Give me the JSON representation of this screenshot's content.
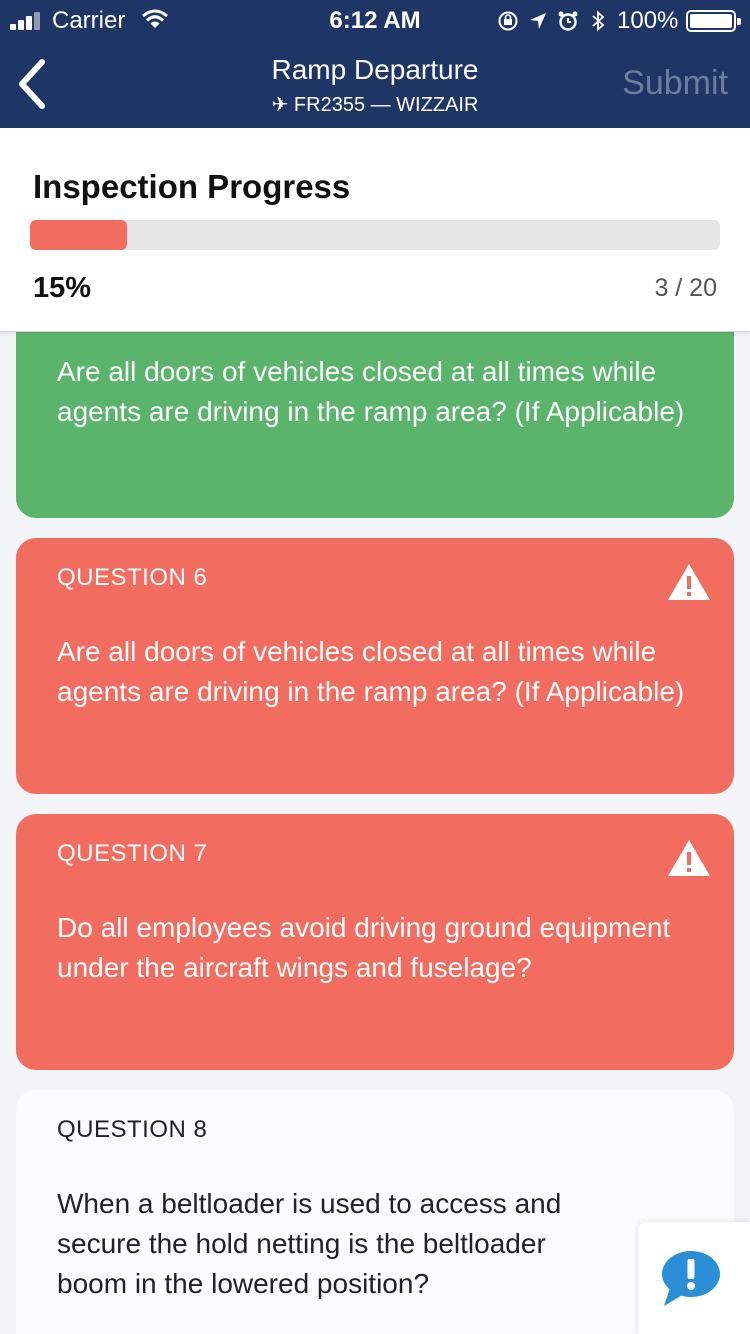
{
  "status_bar": {
    "carrier": "Carrier",
    "time": "6:12 AM",
    "battery": "100%"
  },
  "nav": {
    "title": "Ramp Departure",
    "subtitle": "✈ FR2355 — WIZZAIR",
    "submit_label": "Submit"
  },
  "progress": {
    "title": "Inspection Progress",
    "percent_label": "15%",
    "percent_value": 0.15,
    "count_label": "3 / 20"
  },
  "questions": [
    {
      "label": "",
      "text": "Are all doors of vehicles closed at all times while agents are driving in the ramp area? (If Applicable)",
      "status": "passed"
    },
    {
      "label": "QUESTION 6",
      "text": "Are all doors of vehicles closed at all times while agents are driving in the ramp area? (If Applicable)",
      "status": "failed"
    },
    {
      "label": "QUESTION 7",
      "text": "Do all employees avoid driving ground equipment under the aircraft wings and fuselage?",
      "status": "failed"
    },
    {
      "label": "QUESTION 8",
      "text": "When a beltloader is used to access and secure the hold netting is the beltloader boom in the lowered position?",
      "status": "pending"
    }
  ],
  "colors": {
    "nav_bg": "#1e3565",
    "pass": "#5ab46b",
    "fail": "#f26c60",
    "accent": "#2b8fd8"
  },
  "icons": {
    "back": "chevron-left-icon",
    "warning": "warning-triangle-icon",
    "help": "exclamation-bubble-icon"
  }
}
